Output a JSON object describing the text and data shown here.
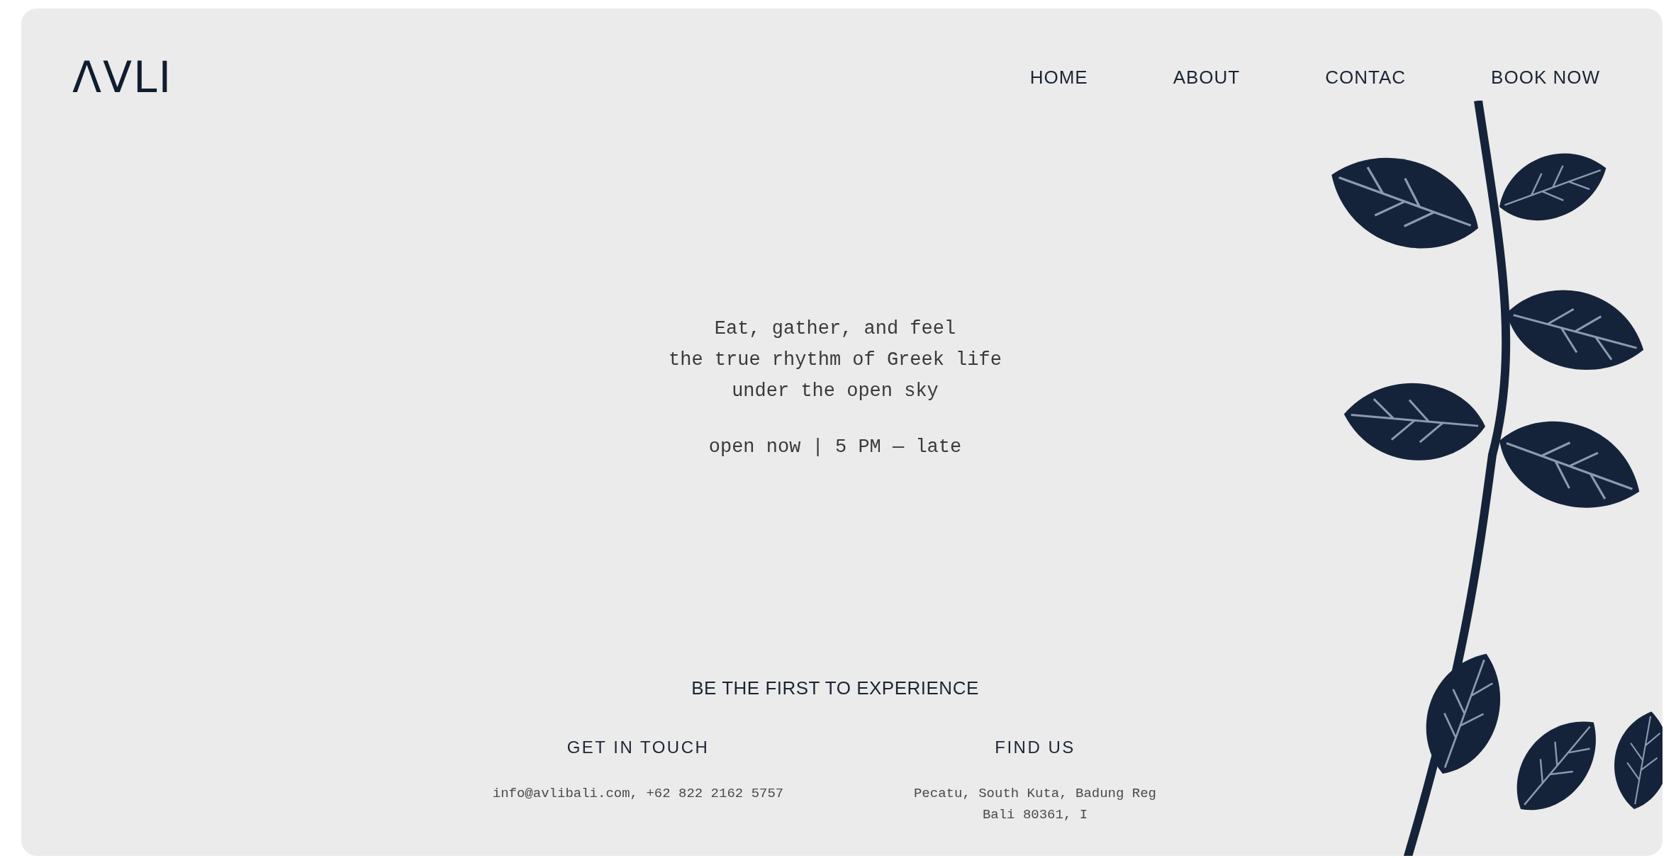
{
  "logo": "ΛVLI",
  "nav": [
    {
      "label": "HOME"
    },
    {
      "label": "ABOUT"
    },
    {
      "label": "CONTAC"
    },
    {
      "label": "BOOK NOW"
    }
  ],
  "hero": {
    "lines": [
      "Eat, gather, and feel",
      "the true rhythm of Greek life",
      "under the open sky"
    ],
    "hours": "open now | 5 PM — late"
  },
  "cta": "BE THE FIRST TO EXPERIENCE",
  "contacts": [
    {
      "heading": "GET IN TOUCH",
      "lines": [
        "info@avlibali.com, +62 822 2162 5757"
      ]
    },
    {
      "heading": "FIND US",
      "lines": [
        "Pecatu, South Kuta, Badung Reg",
        "Bali 80361, I"
      ]
    }
  ]
}
